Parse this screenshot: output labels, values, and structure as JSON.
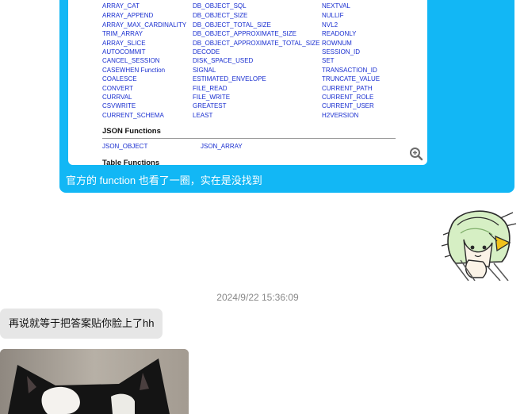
{
  "messages": {
    "out_caption": "官方的 function 也看了一圈，实在是没找到",
    "timestamp": "2024/9/22 15:36:09",
    "in_text": "再说就等于把答案贴你脸上了hh"
  },
  "doc": {
    "col1": [
      "ARRAY_CAT",
      "ARRAY_APPEND",
      "ARRAY_MAX_CARDINALITY",
      "TRIM_ARRAY",
      "ARRAY_SLICE",
      "AUTOCOMMIT",
      "CANCEL_SESSION",
      "CASEWHEN Function",
      "COALESCE",
      "CONVERT",
      "CURRVAL",
      "CSVWRITE",
      "CURRENT_SCHEMA"
    ],
    "col2": [
      "DB_OBJECT_SQL",
      "DB_OBJECT_SIZE",
      "DB_OBJECT_TOTAL_SIZE",
      "DB_OBJECT_APPROXIMATE_SIZE",
      "DB_OBJECT_APPROXIMATE_TOTAL_SIZE",
      "DECODE",
      "DISK_SPACE_USED",
      "SIGNAL",
      "ESTIMATED_ENVELOPE",
      "FILE_READ",
      "FILE_WRITE",
      "GREATEST",
      "LEAST"
    ],
    "col3": [
      "NEXTVAL",
      "NULLIF",
      "NVL2",
      "READONLY",
      "ROWNUM",
      "SESSION_ID",
      "SET",
      "TRANSACTION_ID",
      "TRUNCATE_VALUE",
      "CURRENT_PATH",
      "CURRENT_ROLE",
      "CURRENT_USER",
      "H2VERSION"
    ],
    "json_title": "JSON Functions",
    "json_items": [
      "JSON_OBJECT",
      "JSON_ARRAY"
    ],
    "table_title": "Table Functions"
  },
  "icons": {
    "zoom": "zoom-in-icon",
    "sticker": "anime-sticker"
  },
  "colors": {
    "bubble_out": "#12b7f5",
    "bubble_in": "#e6e6e6",
    "link": "#1a2fd0"
  }
}
